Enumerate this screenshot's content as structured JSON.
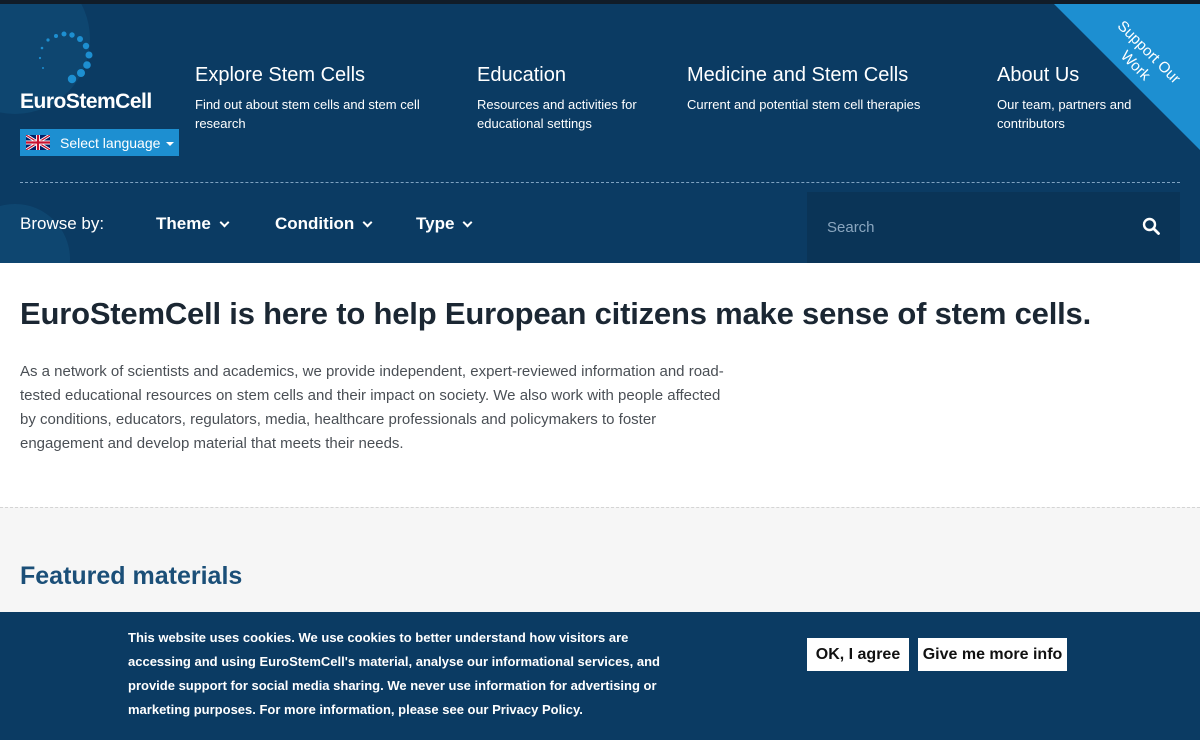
{
  "header": {
    "logo_text": "EuroStemCell",
    "language_button": "Select language",
    "support_ribbon": "Support Our Work",
    "nav": [
      {
        "title": "Explore Stem Cells",
        "desc": "Find out about stem cells and stem cell research"
      },
      {
        "title": "Education",
        "desc": "Resources and activities for educational settings"
      },
      {
        "title": "Medicine and Stem Cells",
        "desc": "Current and potential stem cell therapies"
      },
      {
        "title": "About Us",
        "desc": "Our team, partners and contributors"
      }
    ],
    "browse_label": "Browse by:",
    "browse_items": [
      "Theme",
      "Condition",
      "Type"
    ],
    "search_placeholder": "Search"
  },
  "main": {
    "headline": "EuroStemCell is here to help European citizens make sense of stem cells.",
    "intro": "As a network of scientists and academics, we provide independent, expert-reviewed information and road-tested educational resources on stem cells and their impact on society. We also work with people affected by conditions, educators, regulators, media, healthcare professionals and policymakers to foster engagement and develop material that meets their needs.",
    "featured_title": "Featured materials"
  },
  "cookie": {
    "text": "This website uses cookies. We use cookies to better understand how visitors are accessing and using EuroStemCell's material, analyse our informational services, and provide support for social media sharing. We never use information for advertising or marketing purposes. For more information, please see our Privacy Policy.",
    "agree_label": "OK, I agree",
    "more_info_label": "Give me more info"
  },
  "colors": {
    "header_bg": "#0b3b63",
    "accent": "#1d8fd1"
  }
}
